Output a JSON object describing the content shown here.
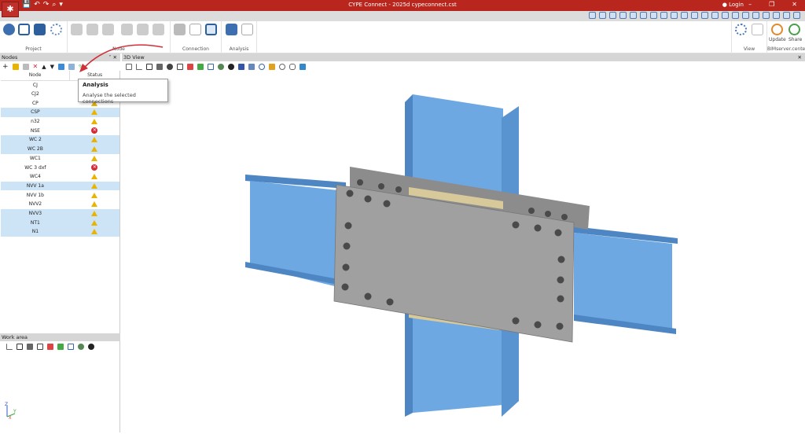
{
  "window": {
    "title": "CYPE Connect - 2025d cypeconnect.cst",
    "login": "Login",
    "minimize": "–",
    "restore": "❐",
    "close": "✕"
  },
  "ribbon": {
    "groups": [
      {
        "label": "Project"
      },
      {
        "label": "Node"
      },
      {
        "label": "Connection"
      },
      {
        "label": "Analysis"
      },
      {
        "label": "View"
      },
      {
        "label": "BIMserver.center"
      }
    ],
    "update": "Update",
    "share": "Share"
  },
  "nodes_panel": {
    "title": "Nodes",
    "columns": [
      "Node",
      "Status"
    ],
    "rows": [
      {
        "node": "CJ",
        "status": "",
        "selected": false
      },
      {
        "node": "CJ2",
        "status": "",
        "selected": false
      },
      {
        "node": "CP",
        "status": "warning",
        "selected": false
      },
      {
        "node": "CSP",
        "status": "warning",
        "selected": true
      },
      {
        "node": "n32",
        "status": "warning",
        "selected": false
      },
      {
        "node": "NSE",
        "status": "error",
        "selected": false
      },
      {
        "node": "WC 2",
        "status": "warning",
        "selected": true
      },
      {
        "node": "WC 2B",
        "status": "warning",
        "selected": true
      },
      {
        "node": "WC1",
        "status": "warning",
        "selected": false
      },
      {
        "node": "WC 3 dxf",
        "status": "error",
        "selected": false
      },
      {
        "node": "WC4",
        "status": "warning",
        "selected": false
      },
      {
        "node": "NVV 1a",
        "status": "warning",
        "selected": true
      },
      {
        "node": "NVV 1b",
        "status": "warning",
        "selected": false
      },
      {
        "node": "NVV2",
        "status": "warning",
        "selected": false
      },
      {
        "node": "NVV3",
        "status": "warning",
        "selected": true
      },
      {
        "node": "NT1",
        "status": "warning",
        "selected": true
      },
      {
        "node": "N1",
        "status": "warning",
        "selected": true
      }
    ]
  },
  "tooltip": {
    "title": "Analysis",
    "text": "Analyse the selected connections"
  },
  "work_area": {
    "title": "Work area"
  },
  "view3d": {
    "title": "3D View"
  },
  "colors": {
    "title_bar": "#b8261d",
    "steel": "#6ea8e2",
    "plate": "#a0a0a0",
    "selection": "#cde4f7",
    "warning": "#e8b400",
    "error": "#d42a3a"
  }
}
